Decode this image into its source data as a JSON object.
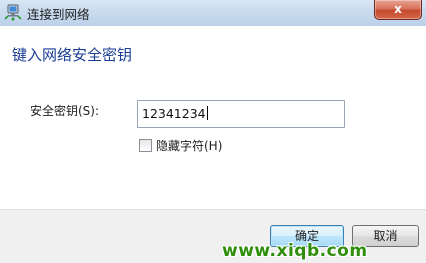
{
  "window": {
    "title": "连接到网络",
    "close_glyph": "x",
    "titlebar_color": "#c7d9ee",
    "close_color": "#c44a2d"
  },
  "dialog": {
    "heading": "键入网络安全密钥",
    "heading_color": "#1a3e94"
  },
  "form": {
    "key_label": "安全密钥(S):",
    "key_value": "12341234",
    "hide_characters_label": "隐藏字符(H)",
    "hide_characters_checked": false
  },
  "buttons": {
    "ok_label": "确定",
    "cancel_label": "取消"
  },
  "watermark": {
    "text": "www.xiqb.com",
    "color": "#2f8f0a"
  },
  "icons": {
    "app": "network-connect-icon",
    "close": "close-icon"
  }
}
